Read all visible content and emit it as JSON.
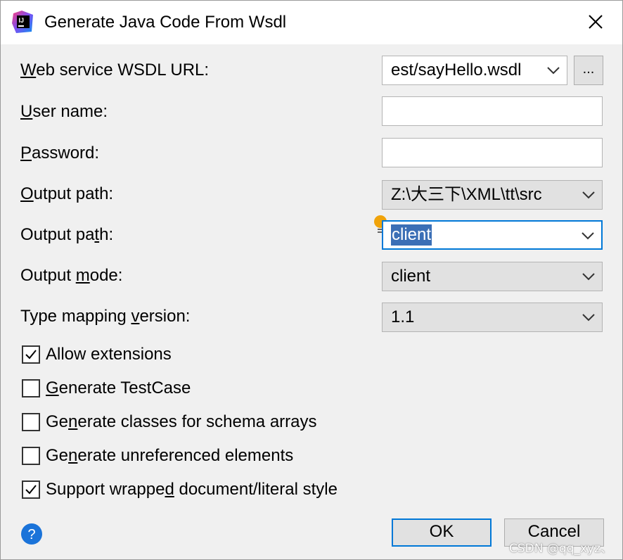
{
  "window": {
    "title": "Generate Java Code From Wsdl",
    "app_icon": "intellij-idea-icon",
    "close_icon": "close-icon"
  },
  "fields": {
    "wsdl_url": {
      "label_pre": "",
      "label_u": "W",
      "label_post": "eb service WSDL URL:",
      "value": "est/sayHello.wsdl",
      "browse_label": "..."
    },
    "user_name": {
      "label_pre": "",
      "label_u": "U",
      "label_post": "ser name:",
      "value": ""
    },
    "password": {
      "label_pre": "",
      "label_u": "P",
      "label_post": "assword:",
      "value": ""
    },
    "output_path": {
      "label_pre": "",
      "label_u": "O",
      "label_post": "utput path:",
      "value": "Z:\\大三下\\XML\\tt\\src"
    },
    "package": {
      "label_pre": "Output pa",
      "label_u": "t",
      "label_post": "h:",
      "value": "client"
    },
    "output_mode": {
      "label_pre": "Output ",
      "label_u": "m",
      "label_post": "ode:",
      "value": "client"
    },
    "type_mapping": {
      "label_pre": "Type mapping ",
      "label_u": "v",
      "label_post": "ersion:",
      "value": "1.1"
    }
  },
  "options": [
    {
      "pre": "",
      "u": "",
      "post": "Allow extensions",
      "checked": true
    },
    {
      "pre": "",
      "u": "G",
      "post": "enerate TestCase",
      "checked": false
    },
    {
      "pre": "Ge",
      "u": "n",
      "post": "erate classes for schema arrays",
      "checked": false
    },
    {
      "pre": "Ge",
      "u": "n",
      "post": "erate unreferenced elements",
      "checked": false
    },
    {
      "pre": "Support wrappe",
      "u": "d",
      "post": " document/literal style",
      "checked": true
    }
  ],
  "footer": {
    "help_icon": "help-icon",
    "ok_label": "OK",
    "cancel_label": "Cancel"
  },
  "watermark": "CSDN @qq_xyz、",
  "colors": {
    "accent": "#0078d7",
    "selection": "#3b6fb6",
    "help": "#1a73d9",
    "bulb": "#f0a30a"
  }
}
